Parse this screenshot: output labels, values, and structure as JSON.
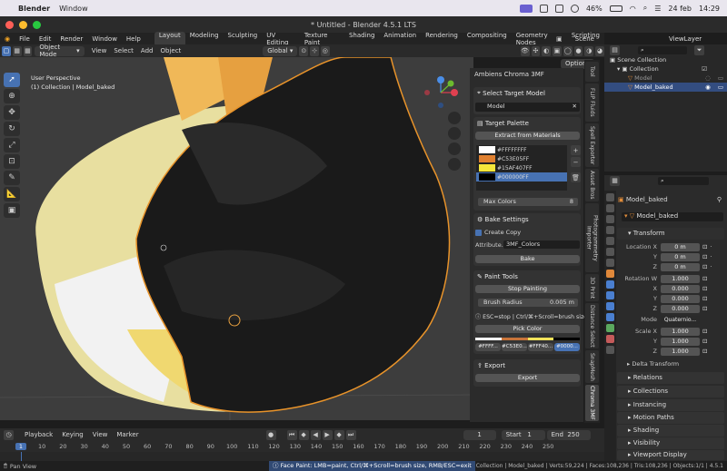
{
  "mac_menubar": {
    "app_name": "Blender",
    "menu_window": "Window",
    "battery": "46%",
    "date": "24 feb",
    "time": "14:29"
  },
  "window_title": "* Untitled - Blender 4.5.1 LTS",
  "top_menu": [
    "File",
    "Edit",
    "Render",
    "Window",
    "Help"
  ],
  "workspaces": [
    "Layout",
    "Modeling",
    "Sculpting",
    "UV Editing",
    "Texture Paint",
    "Shading",
    "Animation",
    "Rendering",
    "Compositing",
    "Geometry Nodes",
    "Scripting"
  ],
  "active_workspace": "Layout",
  "scene": "Scene",
  "view_layer": "ViewLayer",
  "viewport_header": {
    "mode": "Object Mode",
    "menus": [
      "View",
      "Select",
      "Add",
      "Object"
    ],
    "transform_orientation": "Global",
    "options": "Options"
  },
  "viewport_overlay": {
    "line1": "User Perspective",
    "line2": "(1) Collection | Model_baked"
  },
  "n_panel": {
    "tab_header": "Ambiens Chroma 3MF",
    "select_target_label": "Select Target Model",
    "target_model": "Model",
    "target_palette_label": "Target Palette",
    "extract_btn": "Extract from Materials",
    "palette": [
      {
        "hex": "#FFFFFFFF",
        "color": "#ffffff"
      },
      {
        "hex": "#C53E05FF",
        "color": "#e08030"
      },
      {
        "hex": "#15AF407FF",
        "color": "#f5e63a"
      },
      {
        "hex": "#000000FF",
        "color": "#000000"
      }
    ],
    "max_colors_label": "Max Colors",
    "max_colors_value": "8",
    "bake_settings_label": "Bake Settings",
    "create_copy_label": "Create Copy",
    "attribute_label": "Attribute...",
    "attribute_value": "3MF_Colors",
    "bake_btn": "Bake",
    "paint_tools_label": "Paint Tools",
    "stop_painting_btn": "Stop Painting",
    "brush_radius_label": "Brush Radius",
    "brush_radius_value": "0.005 m",
    "hint_text": "ESC=stop | Ctrl/⌘+Scroll=brush size",
    "pick_color_btn": "Pick Color",
    "swatches": [
      {
        "label": "#FFFF...",
        "color": "#4a4a4a"
      },
      {
        "label": "#C53E0...",
        "color": "#4a4a4a"
      },
      {
        "label": "#FFF40...",
        "color": "#4a4a4a"
      },
      {
        "label": "#0000...",
        "color": "#4772b3"
      }
    ],
    "swatch_bars": [
      "#ffffff",
      "#c8743a",
      "#f2e35a",
      "#000000"
    ],
    "export_label": "Export",
    "export_btn": "Export"
  },
  "vertical_tabs": [
    "Tool",
    "FLIP Fluids",
    "Spell Exporter",
    "Asset Bros",
    "Photogrammetry Importer",
    "3D Print",
    "Distance Select",
    "SnapMesh",
    "Chroma 3MF"
  ],
  "outliner": {
    "root": "Scene Collection",
    "collection": "Collection",
    "items": [
      "Model",
      "Model_baked"
    ],
    "search_placeholder": ""
  },
  "properties": {
    "object_name": "Model_baked",
    "data_name": "Model_baked",
    "transform_label": "Transform",
    "location_label": "Location X",
    "location": [
      "0 m",
      "0 m",
      "0 m"
    ],
    "rotation_label": "Rotation W",
    "rotation": [
      "1.000",
      "0.000",
      "0.000",
      "0.000"
    ],
    "mode_label": "Mode",
    "mode_value": "Quaternio...",
    "scale_label": "Scale X",
    "scale": [
      "1.000",
      "1.000",
      "1.000"
    ],
    "axis_labels": [
      "X",
      "Y",
      "Z"
    ],
    "wxyz_labels": [
      "W",
      "X",
      "Y",
      "Z"
    ],
    "delta_transform": "Delta Transform",
    "collapsed_sections": [
      "Relations",
      "Collections",
      "Instancing",
      "Motion Paths",
      "Shading",
      "Visibility",
      "Viewport Display"
    ]
  },
  "timeline": {
    "menus": [
      "Playback",
      "Keying",
      "View",
      "Marker"
    ],
    "current_frame": "1",
    "start_label": "Start",
    "start_value": "1",
    "end_label": "End",
    "end_value": "250",
    "ticks": [
      "1",
      "10",
      "20",
      "30",
      "40",
      "50",
      "60",
      "70",
      "80",
      "90",
      "100",
      "110",
      "120",
      "130",
      "140",
      "150",
      "160",
      "170",
      "180",
      "190",
      "200",
      "210",
      "220",
      "230",
      "240",
      "250"
    ]
  },
  "statusbar": {
    "left": "Pan View",
    "center": "Face Paint: LMB=paint, Ctrl/⌘+Scroll=brush size, RMB/ESC=exit",
    "right": "Collection | Model_baked | Verts:59,224 | Faces:108,236 | Tris:108,236 | Objects:1/1 | 4.5.1"
  }
}
